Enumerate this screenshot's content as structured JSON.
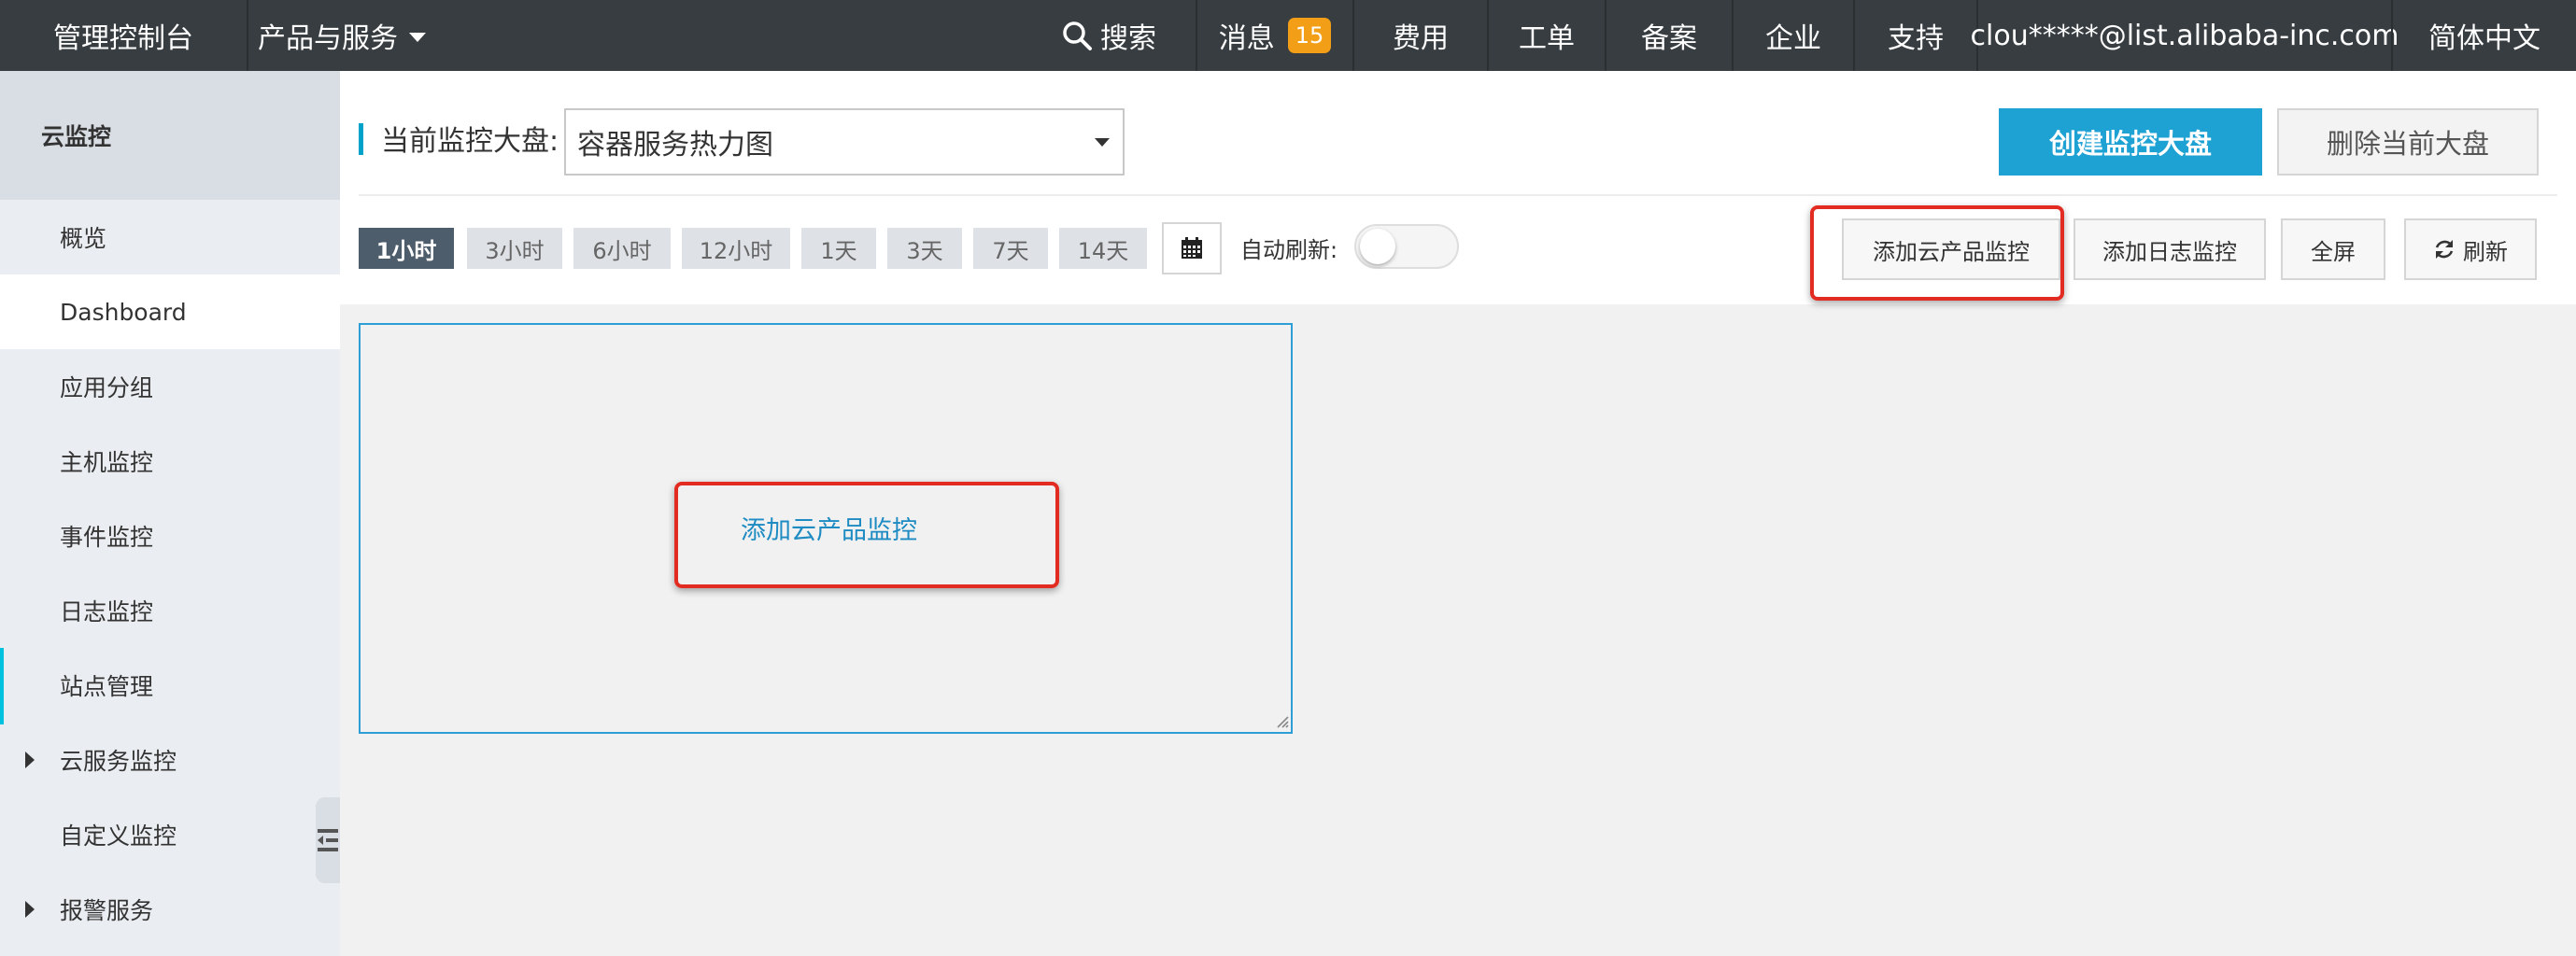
{
  "topbar": {
    "console": "管理控制台",
    "products": "产品与服务",
    "search": "搜索",
    "messages": "消息",
    "message_count": "15",
    "billing": "费用",
    "tickets": "工单",
    "icp": "备案",
    "enterprise": "企业",
    "support": "支持",
    "account": "clou*****@list.alibaba-inc.com",
    "language": "简体中文"
  },
  "sidebar": {
    "title": "云监控",
    "items": [
      {
        "label": "概览",
        "expandable": false,
        "active": false
      },
      {
        "label": "Dashboard",
        "expandable": false,
        "active": true
      },
      {
        "label": "应用分组",
        "expandable": false,
        "active": false
      },
      {
        "label": "主机监控",
        "expandable": false,
        "active": false
      },
      {
        "label": "事件监控",
        "expandable": false,
        "active": false
      },
      {
        "label": "日志监控",
        "expandable": false,
        "active": false
      },
      {
        "label": "站点管理",
        "expandable": false,
        "active": false
      },
      {
        "label": "云服务监控",
        "expandable": true,
        "active": false
      },
      {
        "label": "自定义监控",
        "expandable": false,
        "active": false
      },
      {
        "label": "报警服务",
        "expandable": true,
        "active": false
      }
    ]
  },
  "header": {
    "dashboard_label": "当前监控大盘:",
    "dashboard_selected": "容器服务热力图",
    "create_button": "创建监控大盘",
    "delete_button": "删除当前大盘"
  },
  "toolbar": {
    "time_ranges": [
      "1小时",
      "3小时",
      "6小时",
      "12小时",
      "1天",
      "3天",
      "7天",
      "14天"
    ],
    "active_range": "1小时",
    "auto_refresh_label": "自动刷新:",
    "auto_refresh_on": false,
    "add_cloud_product": "添加云产品监控",
    "add_log": "添加日志监控",
    "fullscreen": "全屏",
    "refresh": "刷新"
  },
  "canvas": {
    "widget_link": "添加云产品监控"
  },
  "colors": {
    "topbar_bg": "#373d41",
    "accent_blue": "#1ea1d3",
    "badge_orange": "#f29e17",
    "highlight_red": "#e22b21",
    "sidebar_bg": "#eaedf1"
  }
}
